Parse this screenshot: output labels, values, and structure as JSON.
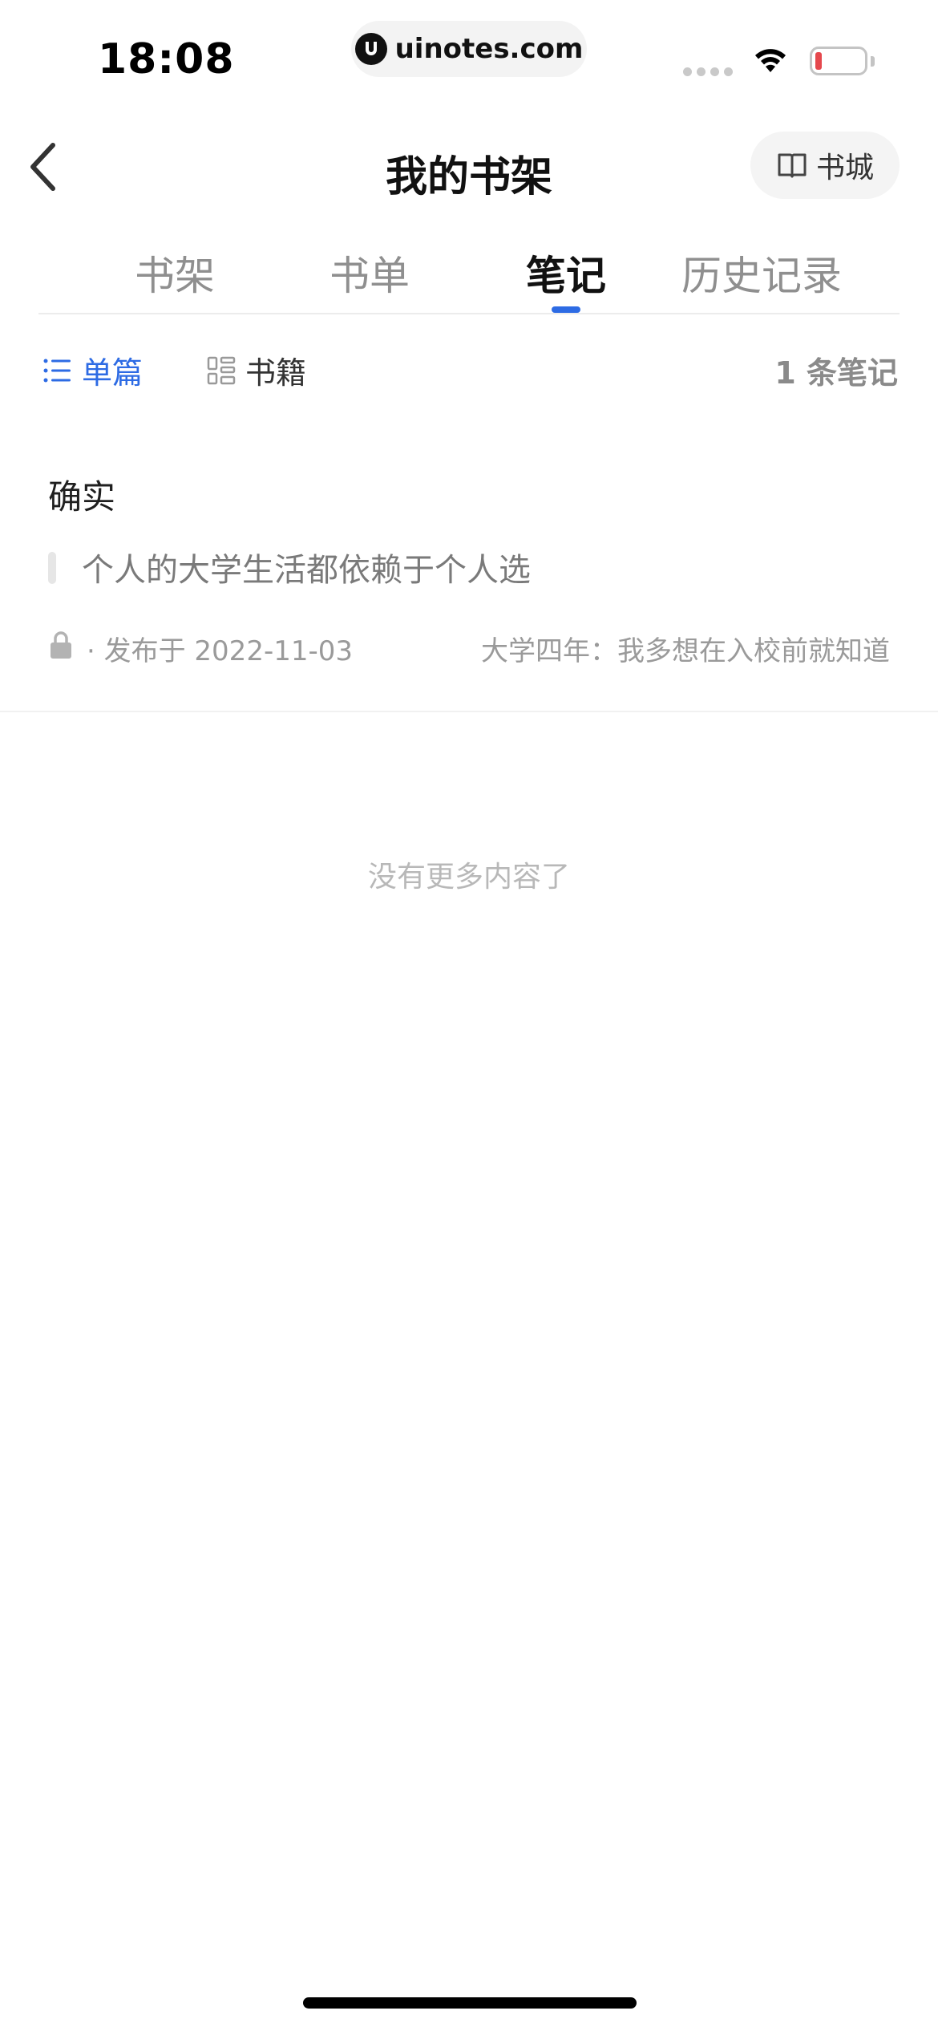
{
  "status_bar": {
    "time": "18:08",
    "url": "uinotes.com",
    "battery_color": "#e5484d"
  },
  "header": {
    "back_icon": "chevron-left-icon",
    "title": "我的书架",
    "store_icon": "book-open-icon",
    "store_label": "书城"
  },
  "tabs": [
    {
      "label": "书架",
      "active": false
    },
    {
      "label": "书单",
      "active": false
    },
    {
      "label": "笔记",
      "active": true
    },
    {
      "label": "历史记录",
      "active": false
    }
  ],
  "toolbar": {
    "single_label": "单篇",
    "single_icon": "list-icon",
    "book_label": "书籍",
    "book_icon": "grid-list-icon",
    "count_text": "1 条笔记",
    "accent_color": "#2d6be4"
  },
  "notes": [
    {
      "title": "确实",
      "quote": "个人的大学生活都依赖于个人选",
      "privacy_icon": "lock-icon",
      "date_text": "· 发布于 2022-11-03",
      "source": "大学四年：我多想在入校前就知道"
    }
  ],
  "footer": {
    "end_text": "没有更多内容了"
  }
}
